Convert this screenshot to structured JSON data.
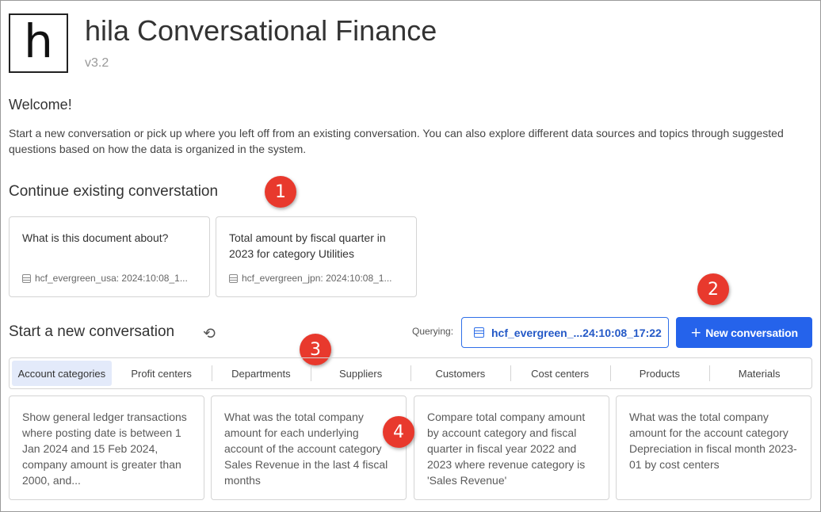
{
  "app": {
    "logo_letter": "h",
    "title": "hila Conversational Finance",
    "version": "v3.2"
  },
  "welcome": {
    "heading": "Welcome!",
    "text": "Start a new conversation or pick up where you left off from an existing conversation. You can also explore different data sources and topics through suggested questions based on how the data is organized in the system."
  },
  "existing": {
    "title": "Continue existing converstation",
    "conversations": [
      {
        "question": "What is this document about?",
        "source": "hcf_evergreen_usa: 2024:10:08_1..."
      },
      {
        "question": "Total amount by fiscal quarter in 2023 for category Utilities",
        "source": "hcf_evergreen_jpn: 2024:10:08_1..."
      }
    ]
  },
  "new_conversation": {
    "title": "Start a new conversation",
    "querying_label": "Querying:",
    "source_value": "hcf_evergreen_...24:10:08_17:22",
    "button_label": "New conversation",
    "button_icon": "+",
    "refresh_icon": "⟲"
  },
  "tabs": [
    "Account categories",
    "Profit centers",
    "Departments",
    "Suppliers",
    "Customers",
    "Cost centers",
    "Products",
    "Materials"
  ],
  "active_tab": 0,
  "suggestions": [
    "Show general ledger transactions where posting date is between 1 Jan 2024 and 15 Feb 2024, company amount is greater than 2000, and...",
    "What was the total company amount for each underlying account of the account category Sales Revenue in the last 4 fiscal months",
    "Compare total company amount by account category and fiscal quarter in fiscal year 2022 and 2023 where revenue category is 'Sales Revenue'",
    "What was the total company amount for the account category Depreciation in fiscal month 2023-01 by cost centers"
  ],
  "callouts": [
    "1",
    "2",
    "3",
    "4"
  ],
  "colors": {
    "primary": "#2563eb",
    "callout": "#e8392d",
    "active_tab_bg": "#e3eafa"
  }
}
